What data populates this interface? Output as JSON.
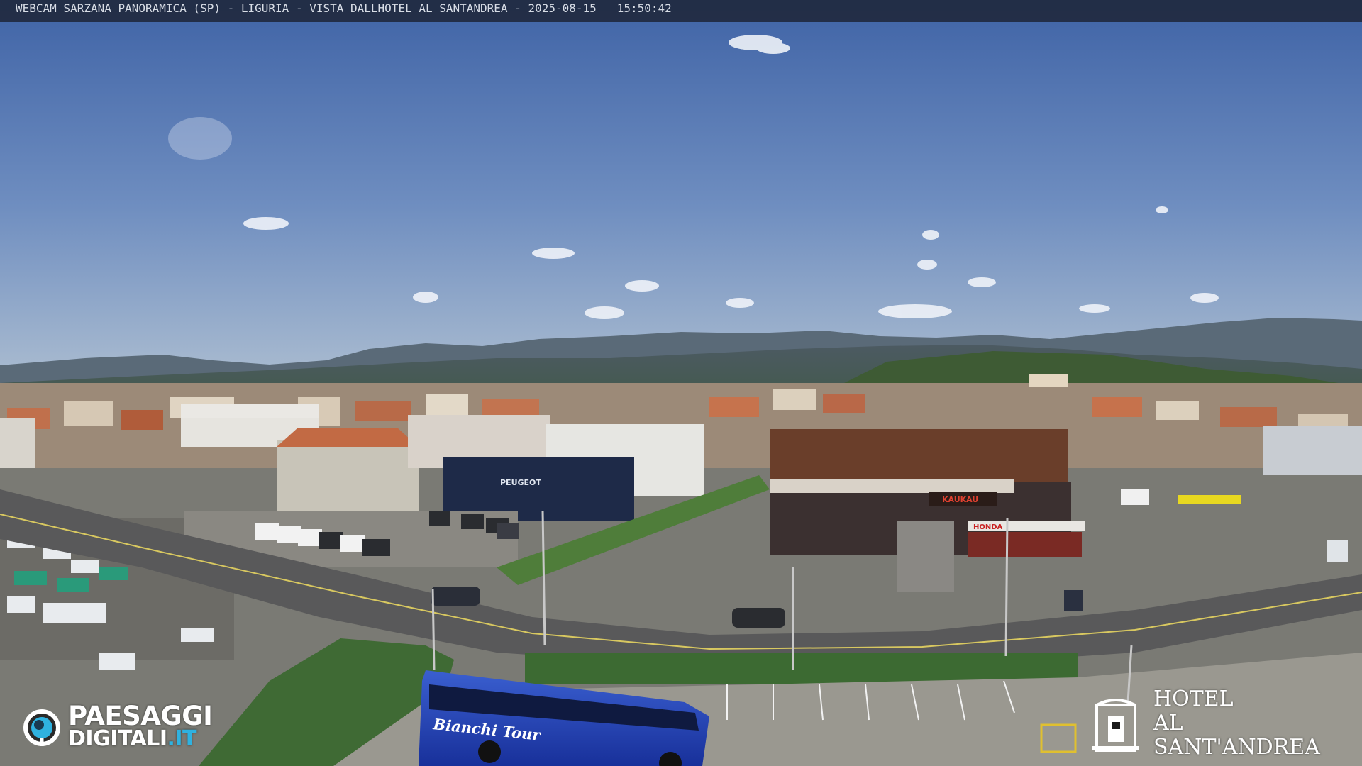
{
  "overlay": {
    "caption": "WEBCAM SARZANA PANORAMICA (SP) - LIGURIA - VISTA DALLHOTEL AL SANTANDREA - 2025-08-15   15:50:42"
  },
  "brand_left": {
    "line1": "PAESAGGI",
    "line2_main": "DIGITALI",
    "line2_tld": ".IT"
  },
  "brand_right": {
    "line1": "HOTEL",
    "line2": "AL SANT'ANDREA"
  },
  "scene_text": {
    "peugeot_sign": "PEUGEOT",
    "restaurant_sign": "KAUKAU",
    "dealer_sign": "HONDA",
    "bus_livery": "Bianchi Tour"
  },
  "colors": {
    "sky_top": "#3f63a6",
    "sky_bottom": "#9fb3cc",
    "bus_blue": "#1f3fa8",
    "brand_accent": "#2fb2e0"
  }
}
